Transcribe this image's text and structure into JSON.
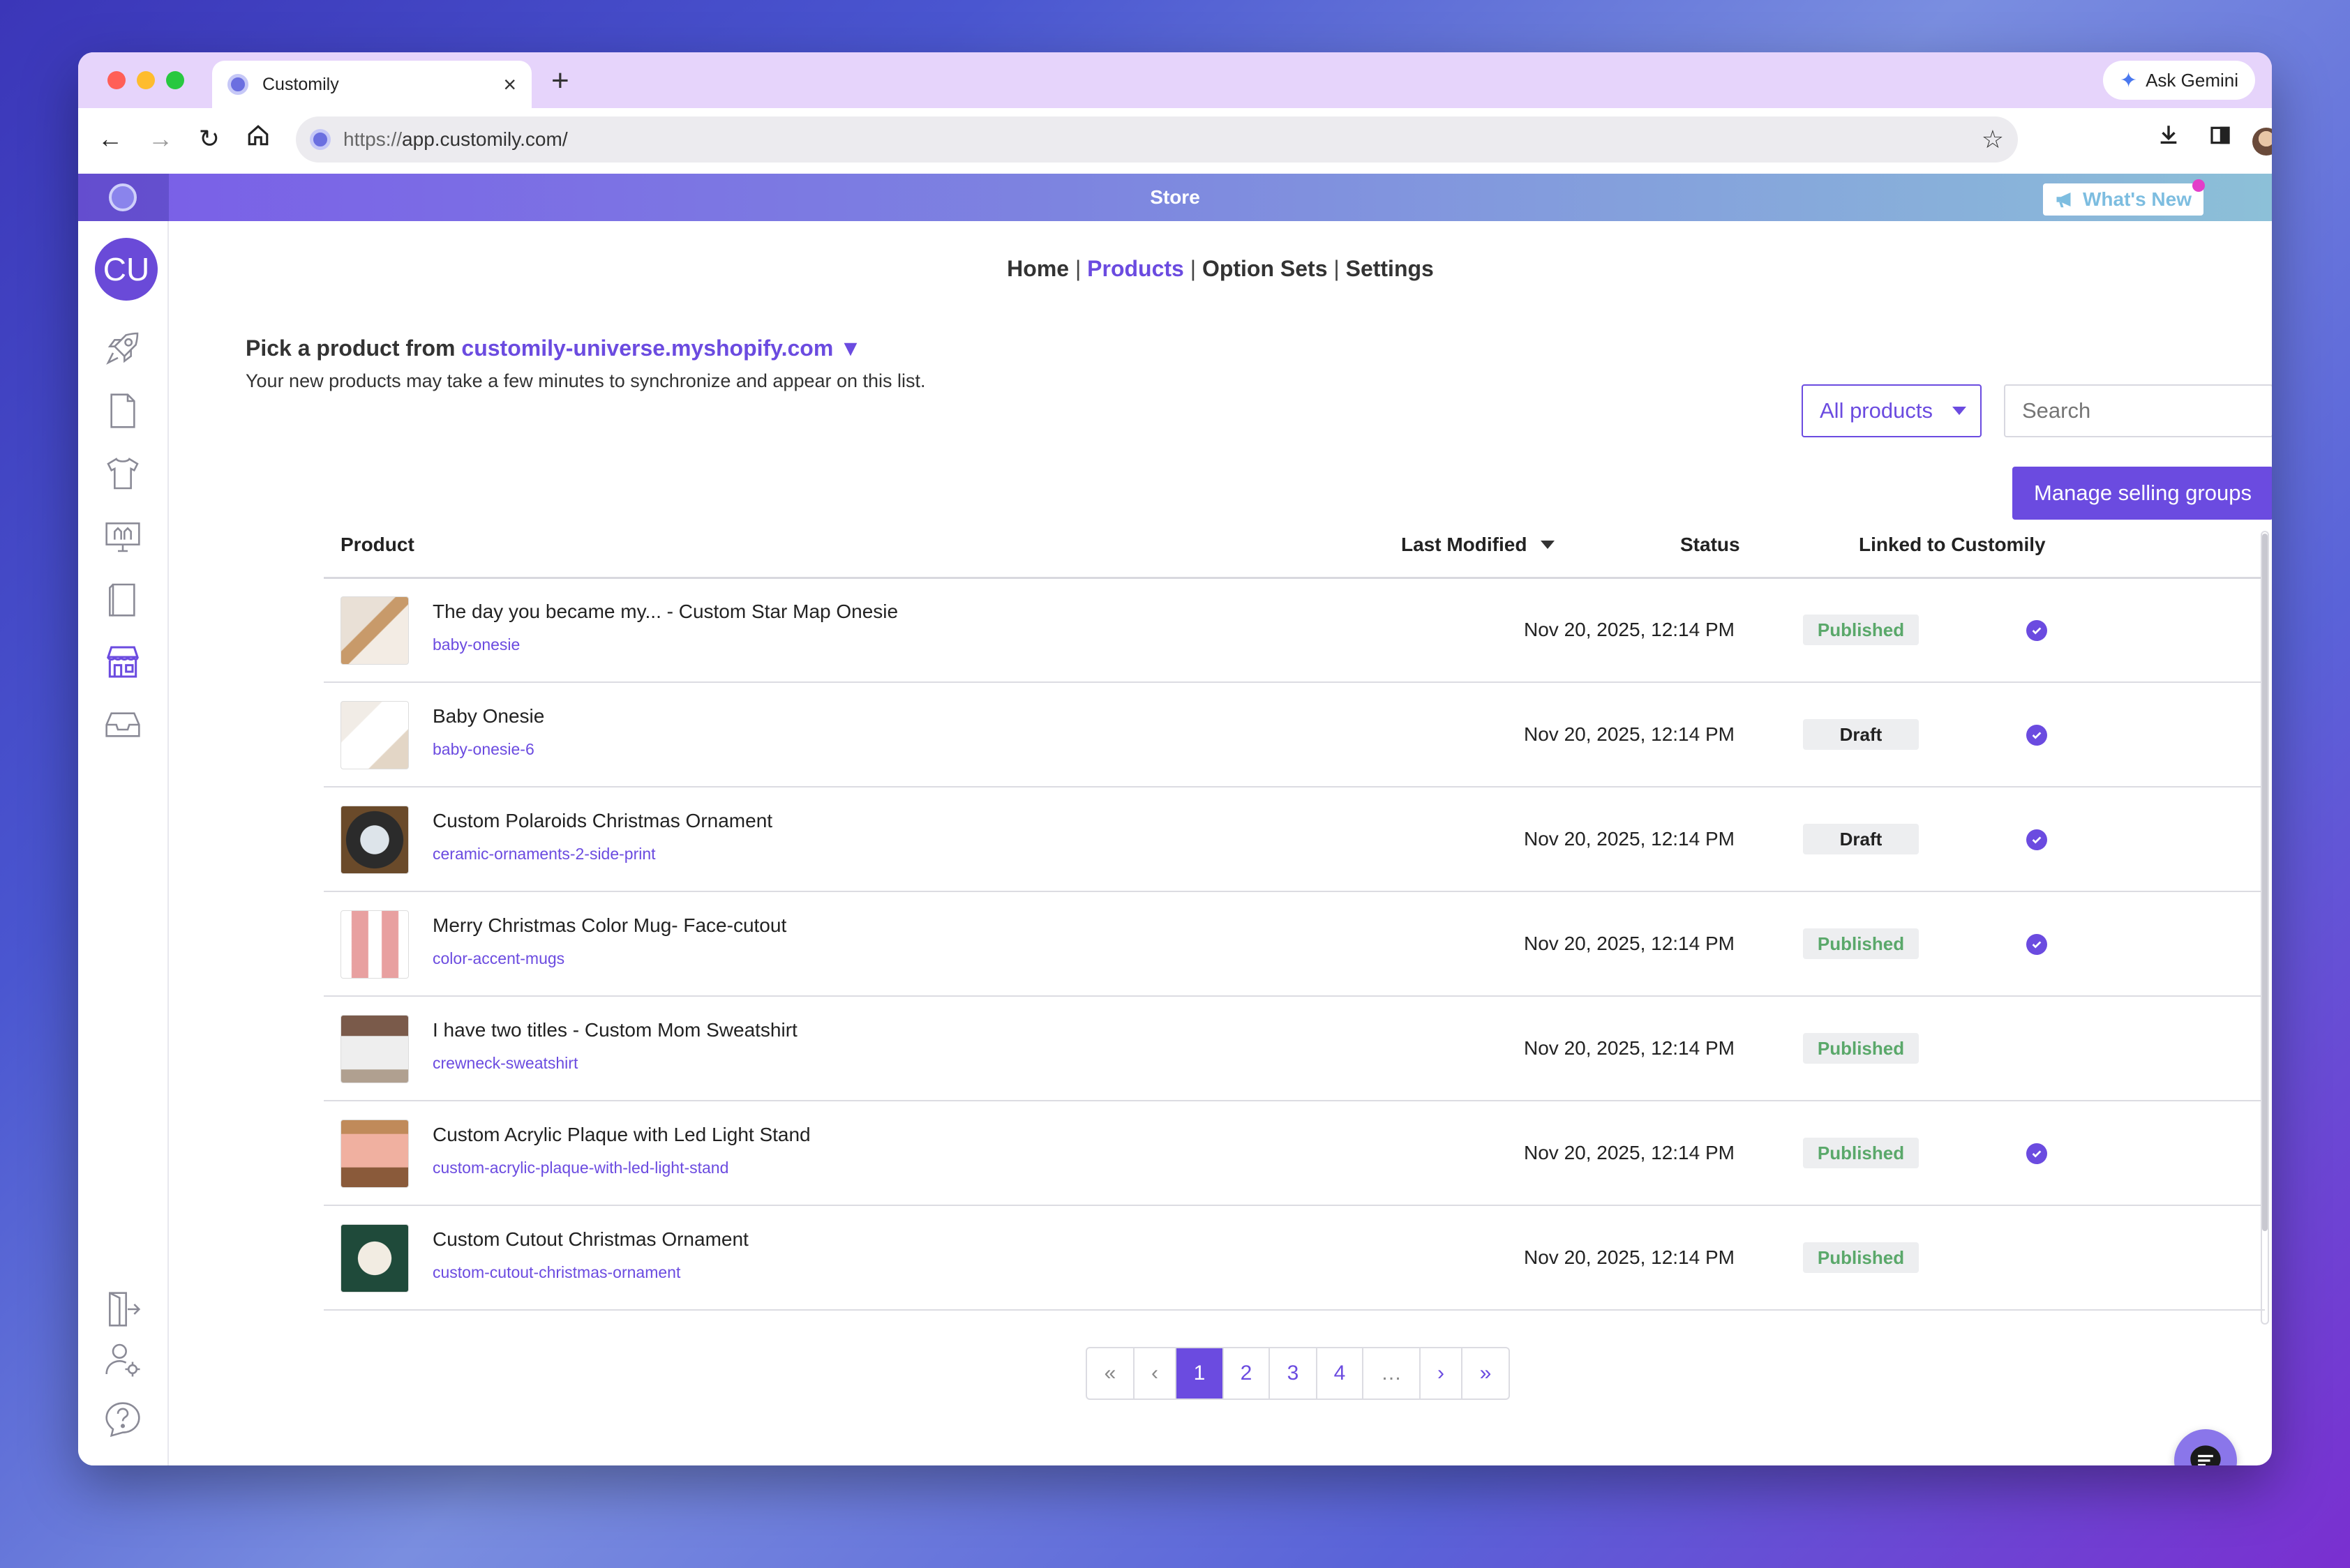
{
  "browser": {
    "tab_title": "Customily",
    "tab_close": "×",
    "new_tab": "+",
    "url_scheme": "https://",
    "url_host": "app.customily.com/",
    "gemini_label": "Ask Gemini"
  },
  "app": {
    "header_title": "Store",
    "whats_new": "What's New",
    "user_initials": "CU"
  },
  "nav": {
    "home": "Home",
    "products": "Products",
    "option_sets": "Option Sets",
    "settings": "Settings",
    "separator": "|"
  },
  "picker": {
    "prefix": "Pick a product from",
    "shop": "customily-universe.myshopify.com",
    "caret": "▼",
    "note": "Your new products may take a few minutes to synchronize and appear on this list."
  },
  "filters": {
    "scope_label": "All products",
    "search_placeholder": "Search",
    "manage_button": "Manage selling groups"
  },
  "table": {
    "columns": {
      "product": "Product",
      "last_modified": "Last Modified",
      "status": "Status",
      "linked": "Linked to Customily"
    },
    "rows": [
      {
        "name": "The day you became my... - Custom Star Map Onesie",
        "slug": "baby-onesie",
        "date": "Nov 20, 2025, 12:14 PM",
        "status": "Published",
        "linked": true
      },
      {
        "name": "Baby Onesie",
        "slug": "baby-onesie-6",
        "date": "Nov 20, 2025, 12:14 PM",
        "status": "Draft",
        "linked": true
      },
      {
        "name": "Custom Polaroids Christmas Ornament",
        "slug": "ceramic-ornaments-2-side-print",
        "date": "Nov 20, 2025, 12:14 PM",
        "status": "Draft",
        "linked": true
      },
      {
        "name": "Merry Christmas Color Mug- Face-cutout",
        "slug": "color-accent-mugs",
        "date": "Nov 20, 2025, 12:14 PM",
        "status": "Published",
        "linked": true
      },
      {
        "name": "I have two titles - Custom Mom Sweatshirt",
        "slug": "crewneck-sweatshirt",
        "date": "Nov 20, 2025, 12:14 PM",
        "status": "Published",
        "linked": false
      },
      {
        "name": "Custom Acrylic Plaque with Led Light Stand",
        "slug": "custom-acrylic-plaque-with-led-light-stand",
        "date": "Nov 20, 2025, 12:14 PM",
        "status": "Published",
        "linked": true
      },
      {
        "name": "Custom Cutout Christmas Ornament",
        "slug": "custom-cutout-christmas-ornament",
        "date": "Nov 20, 2025, 12:14 PM",
        "status": "Published",
        "linked": false
      }
    ]
  },
  "pagination": {
    "first": "«",
    "prev": "‹",
    "pages": [
      "1",
      "2",
      "3",
      "4"
    ],
    "current": "1",
    "ellipsis": "…",
    "next": "›",
    "last": "»"
  },
  "colors": {
    "accent": "#6b4be0",
    "published": "#5aa86a",
    "tab_strip": "#e6d4fb"
  }
}
